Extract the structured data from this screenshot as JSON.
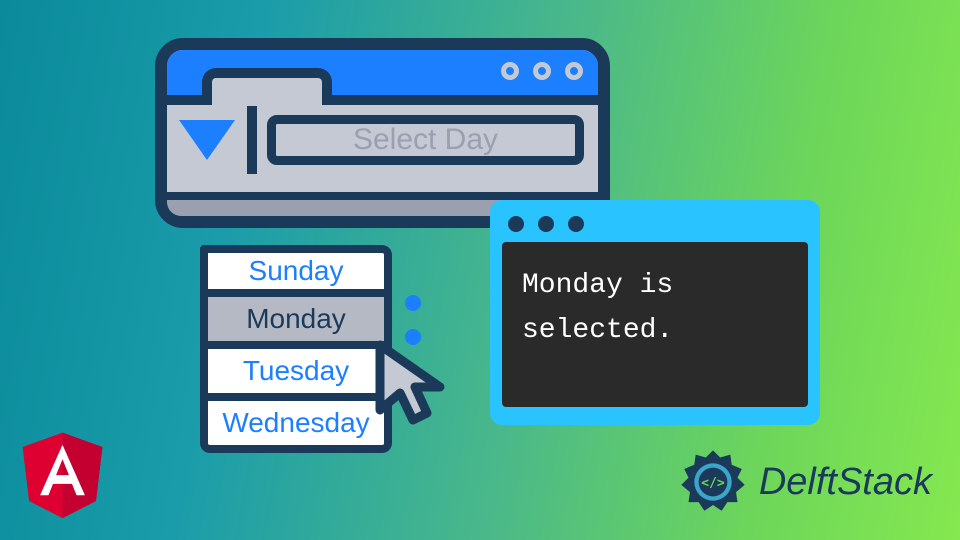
{
  "select": {
    "placeholder": "Select Day",
    "options": [
      "Sunday",
      "Monday",
      "Tuesday",
      "Wednesday"
    ],
    "selected_index": 1
  },
  "terminal": {
    "output": "Monday is selected."
  },
  "branding": {
    "site_name": "DelftStack"
  },
  "icons": {
    "framework": "angular-logo",
    "dropdown": "triangle-down-icon",
    "cursor": "cursor-arrow-icon"
  },
  "colors": {
    "dark_navy": "#1b3a5a",
    "blue": "#1b7fff",
    "cyan": "#29c4ff",
    "gray": "#c5c9d3",
    "angular_red": "#dd0031"
  }
}
